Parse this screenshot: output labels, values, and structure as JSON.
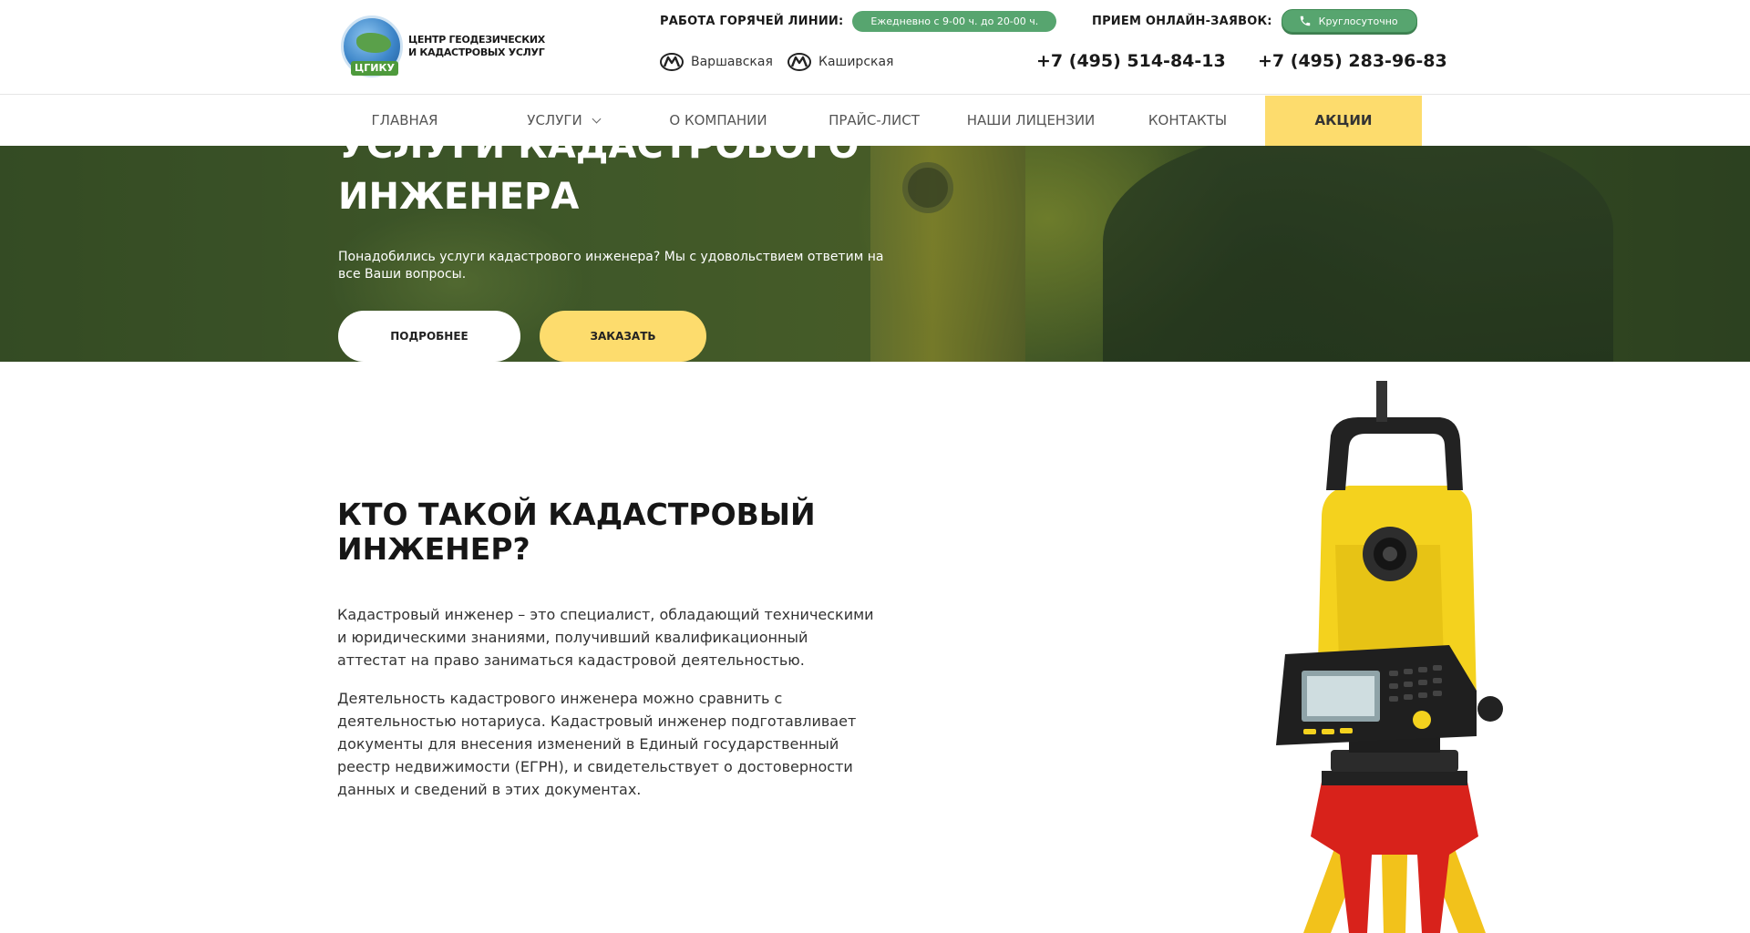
{
  "header": {
    "logo_line1": "ЦЕНТР ГЕОДЕЗИЧЕСКИХ",
    "logo_line2": "И КАДАСТРОВЫХ УСЛУГ",
    "logo_badge": "ЦГИКУ",
    "hotline_label": "РАБОТА ГОРЯЧЕЙ ЛИНИИ:",
    "hotline_hours": "Ежедневно с 9-00 ч. до 20-00 ч.",
    "online_label": "ПРИЕМ ОНЛАЙН-ЗАЯВОК:",
    "online_button": "Круглосуточно",
    "metro": [
      "Варшавская",
      "Каширская"
    ],
    "phones": [
      "+7 (495) 514-84-13",
      "+7 (495) 283-96-83"
    ]
  },
  "nav": {
    "items": [
      "ГЛАВНАЯ",
      "УСЛУГИ",
      "О КОМПАНИИ",
      "ПРАЙС-ЛИСТ",
      "НАШИ ЛИЦЕНЗИИ",
      "КОНТАКТЫ",
      "АКЦИИ"
    ]
  },
  "hero": {
    "title_line1": "УСЛУГИ КАДАСТРОВОГО",
    "title_line2": "ИНЖЕНЕРА",
    "text": "Понадобились услуги кадастрового инженера? Мы с удовольствием ответим на все Ваши вопросы.",
    "btn_more": "ПОДРОБНЕЕ",
    "btn_order": "ЗАКАЗАТЬ"
  },
  "about": {
    "title_line1": "КТО ТАКОЙ КАДАСТРОВЫЙ",
    "title_line2": "ИНЖЕНЕР?",
    "p1": "Кадастровый инженер – это специалист, обладающий техническими и юридическими знаниями, получивший квалификационный аттестат на право заниматься кадастровой деятельностью.",
    "p2": "Деятельность кадастрового инженера можно сравнить с деятельностью нотариуса. Кадастровый инженер подготавливает документы для внесения изменений в Единый государственный реестр недвижимости (ЕГРН), и свидетельствует о достоверности данных и сведений в этих документах."
  },
  "colors": {
    "accent_yellow": "#fddc6d",
    "accent_green": "#57a56f"
  }
}
